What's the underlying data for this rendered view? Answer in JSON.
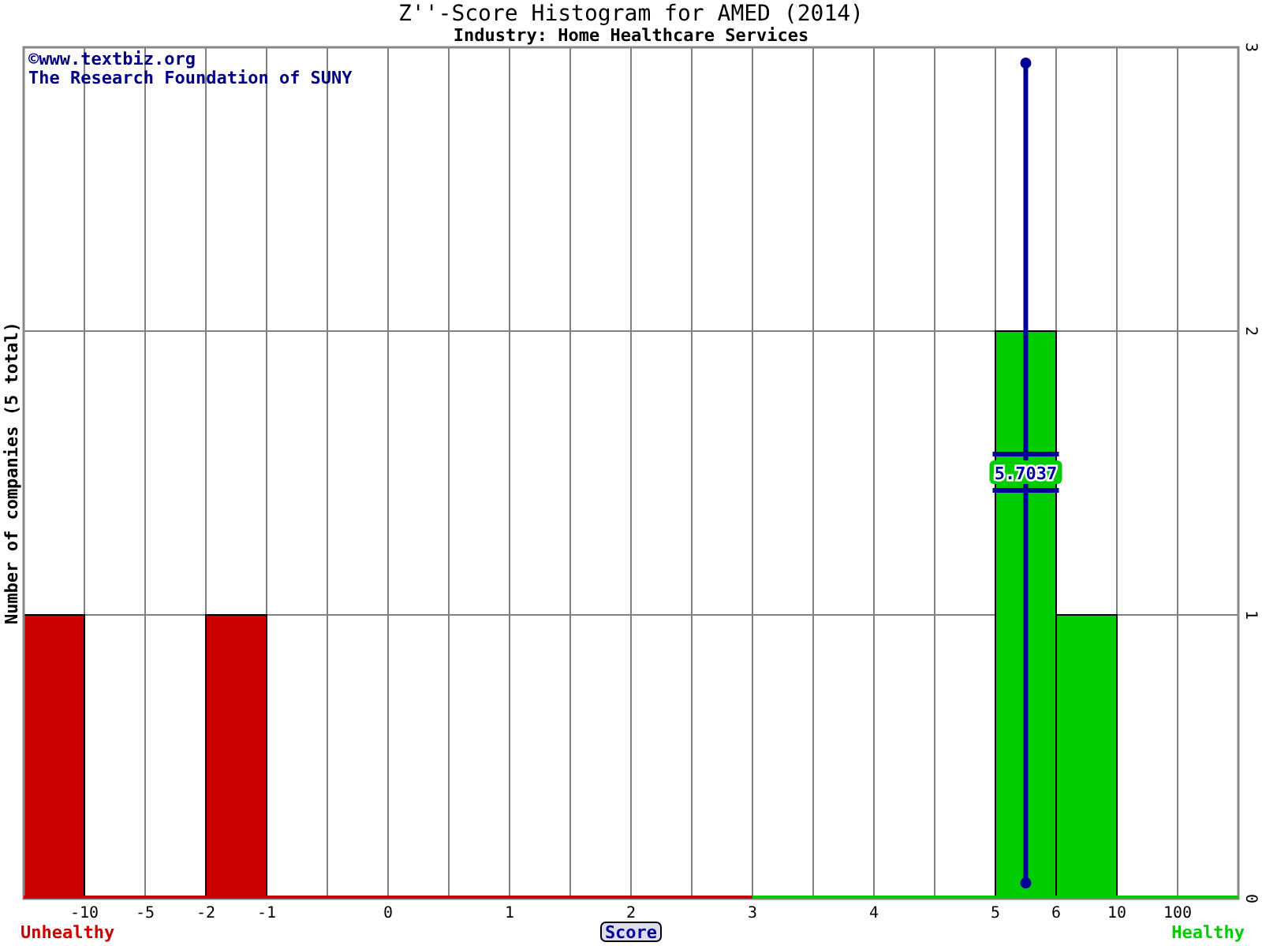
{
  "subtitle": "Industry: Home Healthcare Services",
  "credits": [
    "©www.textbiz.org",
    "The Research Foundation of SUNY"
  ],
  "chart_data": {
    "type": "bar",
    "title": "Z''-Score Histogram for AMED (2014)",
    "xlabel": "Score",
    "ylabel": "Number of companies (5 total)",
    "legend": "bottom",
    "ylim": [
      0,
      3
    ],
    "categories": [
      "-10",
      "-5",
      "-2",
      "-1",
      null,
      "0",
      null,
      "1",
      null,
      "2",
      null,
      "3",
      null,
      "4",
      null,
      "5",
      "6",
      "10",
      "100",
      null
    ],
    "yticks": [
      0,
      1,
      2,
      3
    ],
    "series": [
      {
        "name": "Unhealthy",
        "color": "#cc0000",
        "values": [
          1,
          0,
          0,
          1,
          0,
          0,
          0,
          0,
          0,
          0,
          0,
          0,
          null,
          null,
          null,
          null,
          null,
          null,
          null,
          null
        ]
      },
      {
        "name": "Healthy",
        "color": "#00cc00",
        "values": [
          null,
          null,
          null,
          null,
          null,
          null,
          null,
          null,
          null,
          null,
          null,
          null,
          0,
          0,
          0,
          0,
          2,
          1,
          0,
          0
        ]
      }
    ],
    "grid": true,
    "annotations": [
      "5.7037"
    ]
  }
}
